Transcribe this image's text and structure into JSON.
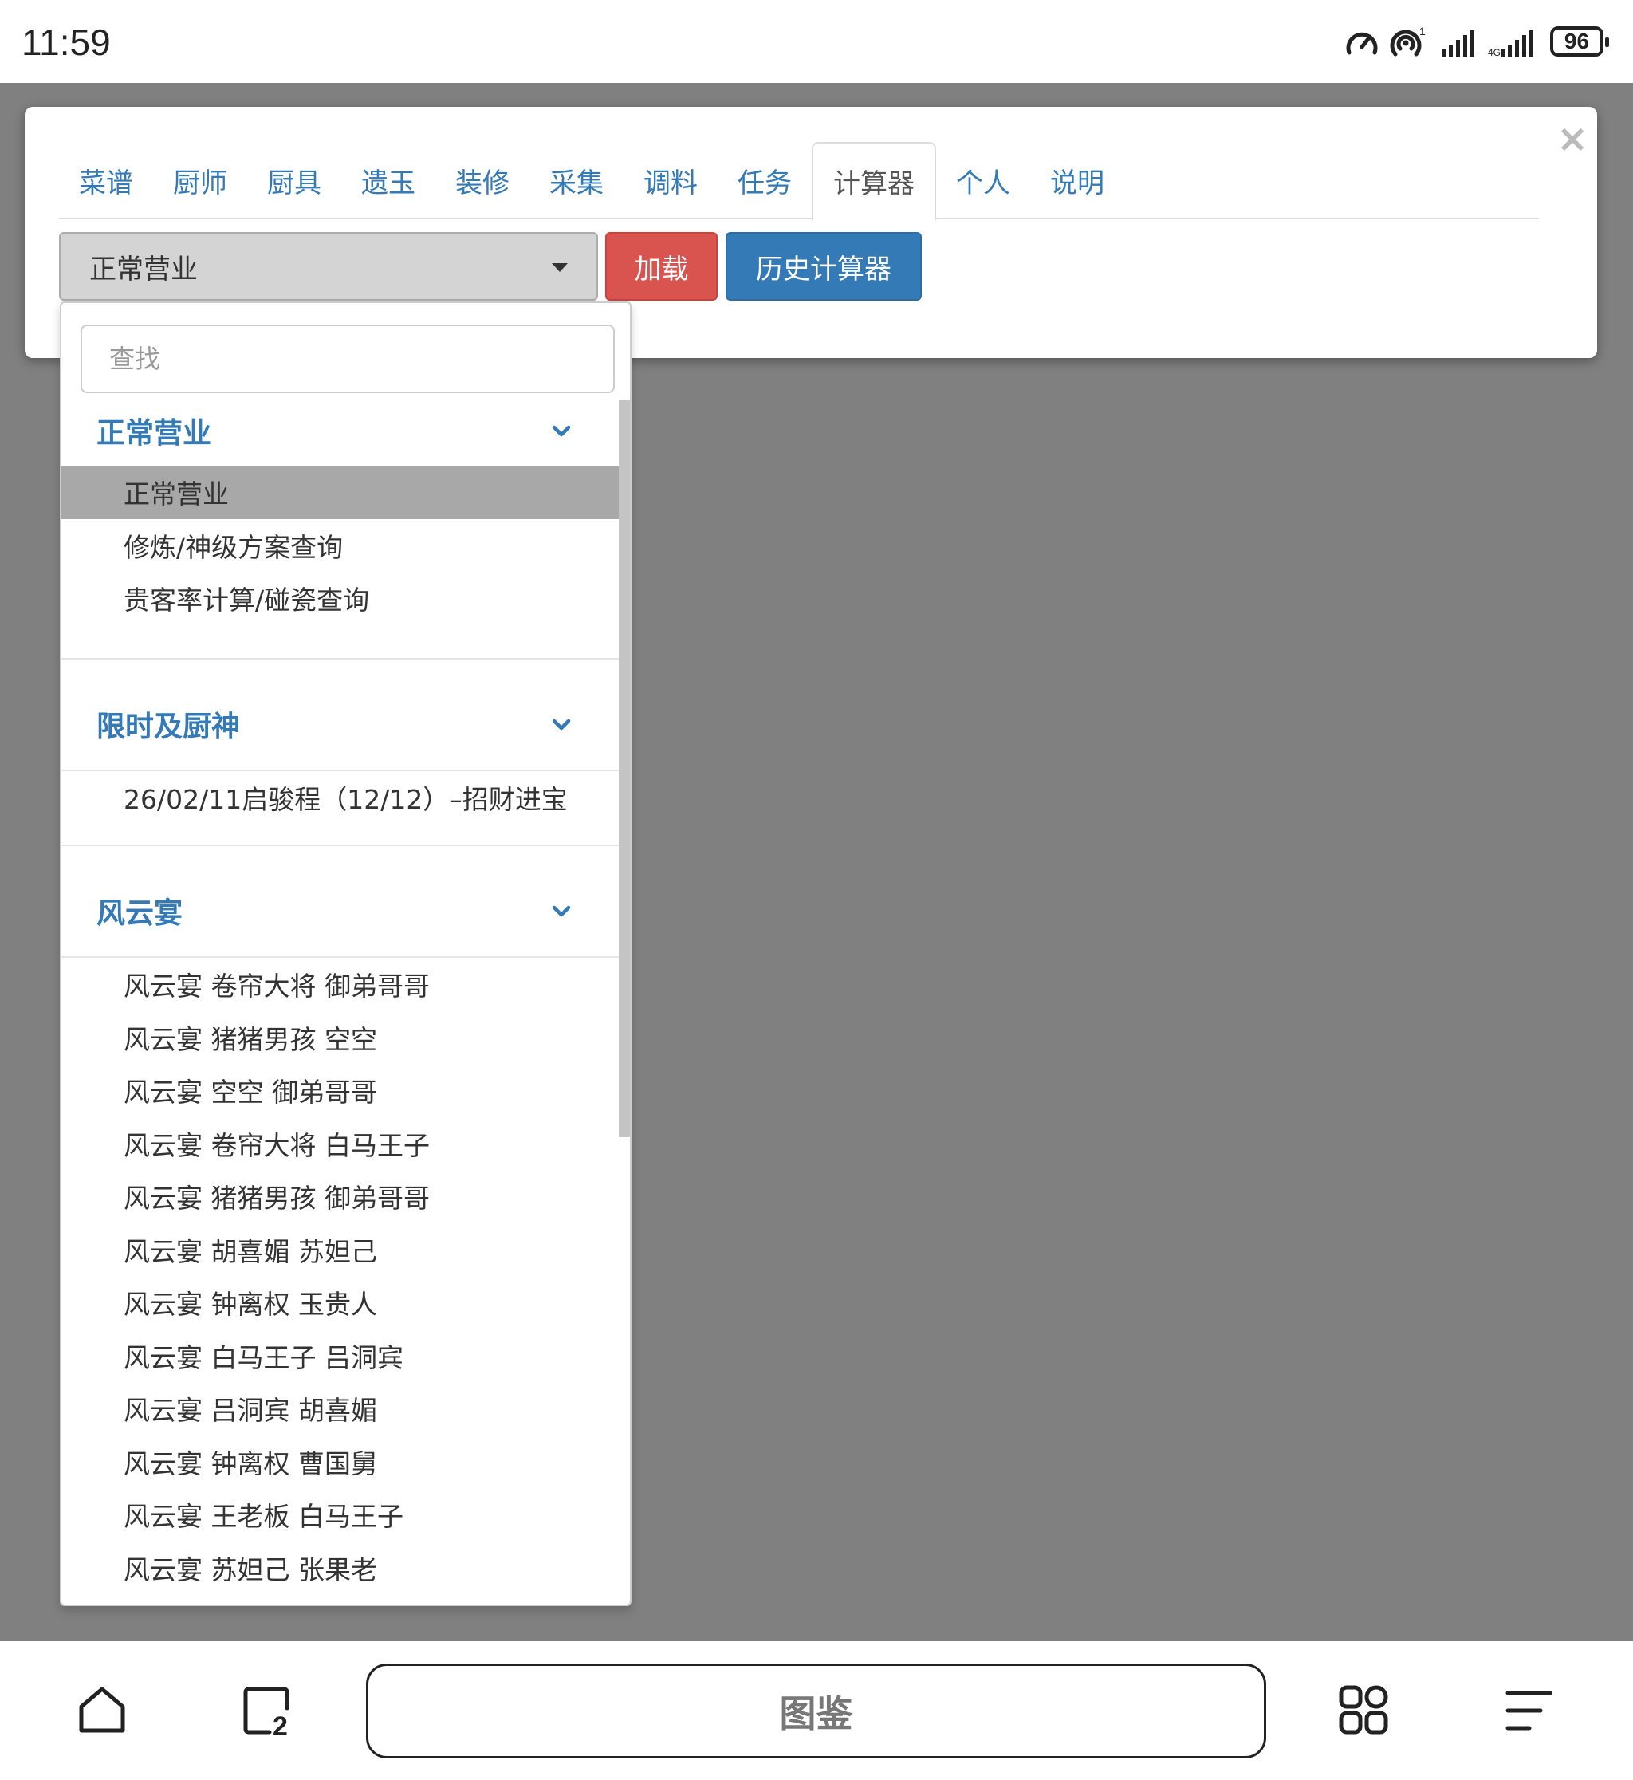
{
  "status_bar": {
    "time": "11:59",
    "battery": "96",
    "signal_label": "1"
  },
  "modal": {
    "close_symbol": "×",
    "tabs": [
      {
        "label": "菜谱"
      },
      {
        "label": "厨师"
      },
      {
        "label": "厨具"
      },
      {
        "label": "遗玉"
      },
      {
        "label": "装修"
      },
      {
        "label": "采集"
      },
      {
        "label": "调料"
      },
      {
        "label": "任务"
      },
      {
        "label": "计算器",
        "active": true
      },
      {
        "label": "个人"
      },
      {
        "label": "说明"
      }
    ],
    "select_value": "正常营业",
    "load_label": "加载",
    "history_label": "历史计算器"
  },
  "dropdown": {
    "search_placeholder": "查找",
    "groups": [
      {
        "name": "正常营业",
        "options": [
          "正常营业",
          "修炼/神级方案查询",
          "贵客率计算/碰瓷查询"
        ]
      },
      {
        "name": "限时及厨神",
        "options": [
          "26/02/11启骏程（12/12）–招财进宝"
        ]
      },
      {
        "name": "风云宴",
        "options": [
          "风云宴 卷帘大将 御弟哥哥",
          "风云宴 猪猪男孩 空空",
          "风云宴 空空 御弟哥哥",
          "风云宴 卷帘大将 白马王子",
          "风云宴 猪猪男孩 御弟哥哥",
          "风云宴 胡喜媚 苏妲己",
          "风云宴 钟离权 玉贵人",
          "风云宴 白马王子 吕洞宾",
          "风云宴 吕洞宾 胡喜媚",
          "风云宴 钟离权 曹国舅",
          "风云宴 王老板 白马王子",
          "风云宴 苏妲己 张果老"
        ]
      }
    ]
  },
  "bottom_nav": {
    "address_text": "图鉴",
    "tabs_count": "2"
  },
  "colors": {
    "accent": "#337ab7",
    "danger": "#d9534f",
    "overlay": "#808080"
  }
}
